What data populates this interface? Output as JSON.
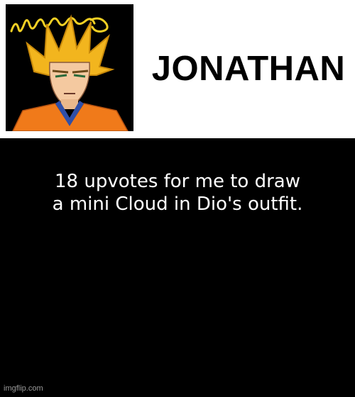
{
  "header": {
    "name": "JONATHAN",
    "avatar": {
      "icon": "anime-character-avatar-icon",
      "signature_text": "yellow signature"
    }
  },
  "caption": {
    "line1": "18 upvotes for me to draw",
    "line2": "a mini Cloud in Dio's outfit."
  },
  "watermark": "imgflip.com",
  "colors": {
    "background": "#000000",
    "header_bg": "#ffffff",
    "text": "#ffffff",
    "hair": "#f2b51e",
    "gi_orange": "#f07a1a",
    "gi_blue": "#2f4fa8"
  }
}
